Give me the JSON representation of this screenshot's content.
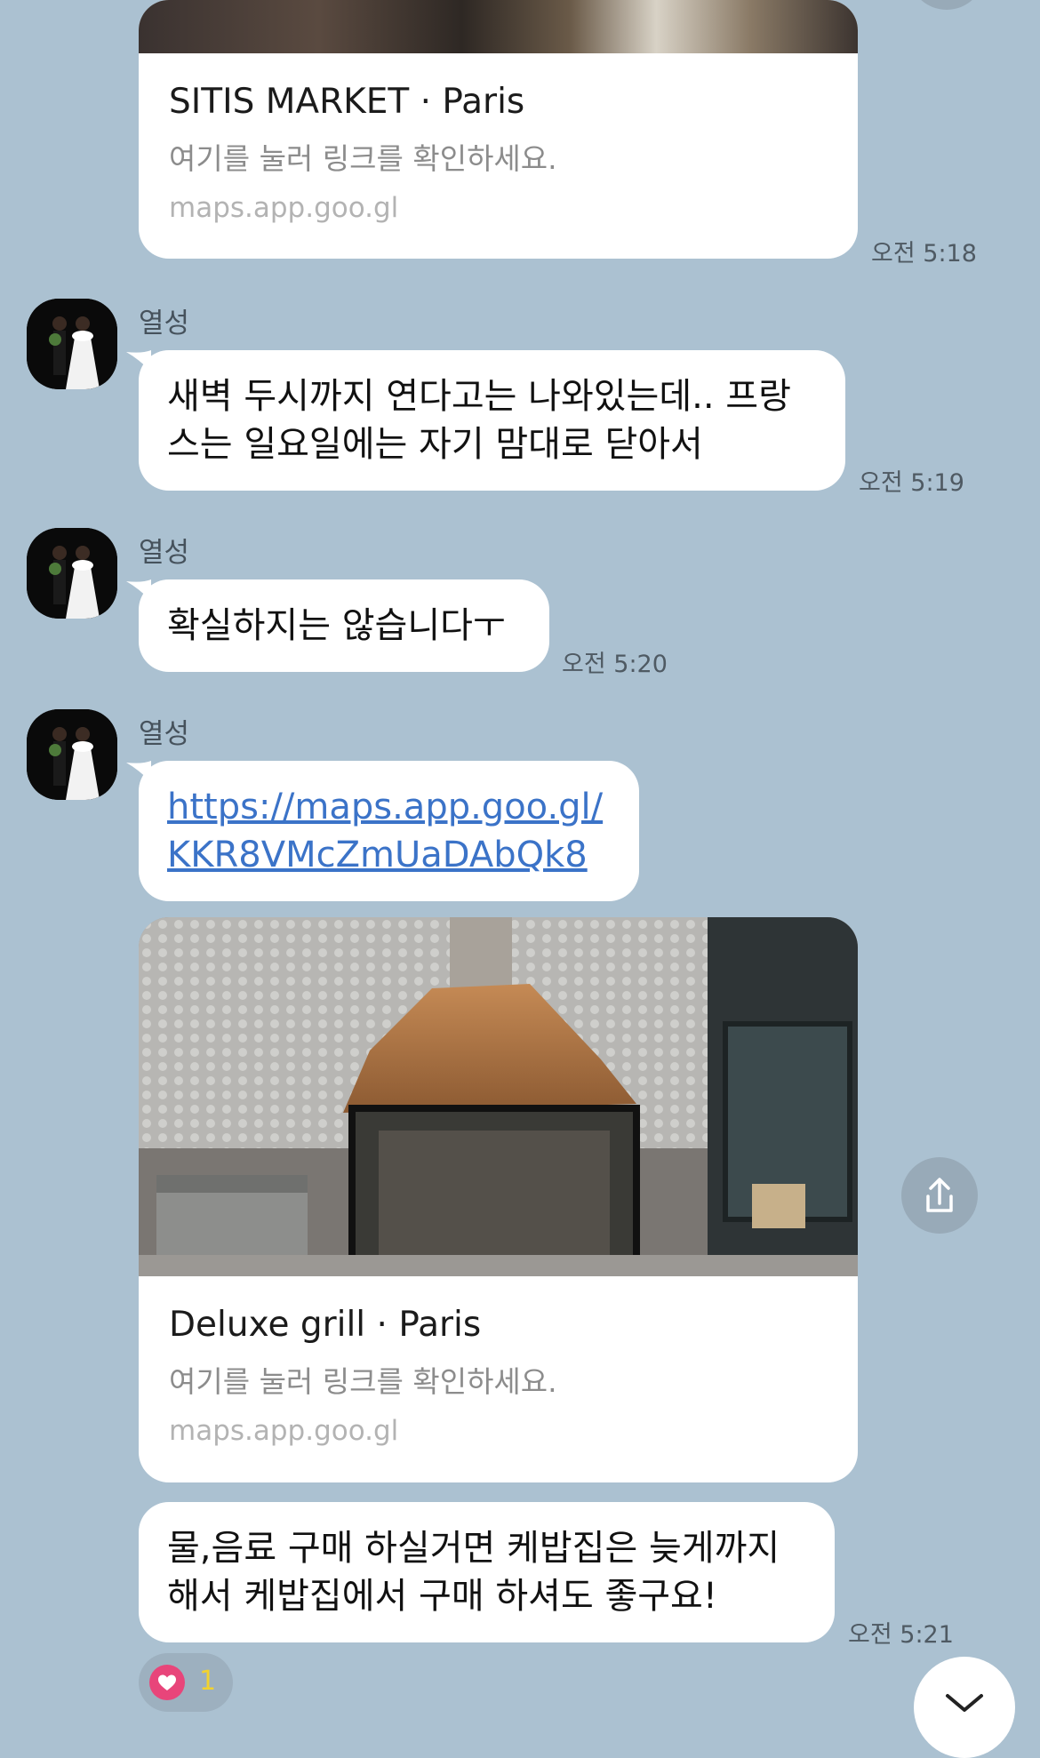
{
  "messages": {
    "card1": {
      "title": "SITIS MARKET · Paris",
      "description": "여기를 눌러 링크를 확인하세요.",
      "domain": "maps.app.goo.gl",
      "time": "오전 5:18"
    },
    "msg2": {
      "sender": "열성",
      "lines": [
        "새벽 두시까지 연다고는 나와있는데.. 프랑",
        "스는 일요일에는 자기 맘대로 닫아서"
      ],
      "time": "오전 5:19"
    },
    "msg3": {
      "sender": "열성",
      "lines": [
        "확실하지는 않습니다ㅜ"
      ],
      "time": "오전 5:20"
    },
    "msg4": {
      "sender": "열성",
      "link_lines": [
        "https://maps.app.goo.gl/",
        "KKR8VMcZmUaDAbQk8"
      ]
    },
    "card2": {
      "title": "Deluxe grill · Paris",
      "description": "여기를 눌러 링크를 확인하세요.",
      "domain": "maps.app.goo.gl"
    },
    "msg5": {
      "lines": [
        "물,음료 구매 하실거면 케밥집은 늦게까지",
        "해서 케밥집에서 구매 하셔도 좋구요!"
      ],
      "time": "오전 5:21",
      "reaction_count": "1"
    }
  },
  "icons": {
    "share": "share-icon",
    "scroll_down": "chevron-down-icon",
    "reaction": "heart-icon"
  },
  "colors": {
    "background": "#abc1d1",
    "bubble": "#ffffff",
    "link": "#3b73c8",
    "heart": "#e8457a"
  }
}
